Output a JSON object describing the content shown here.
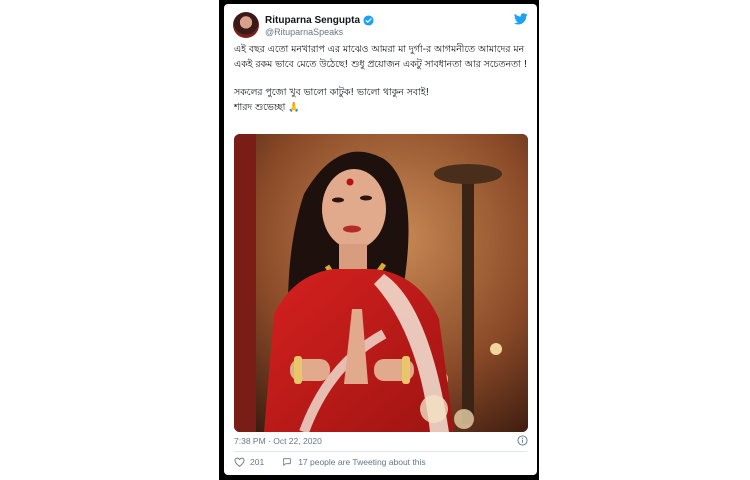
{
  "author": {
    "name": "Rituparna Sengupta",
    "handle": "@RituparnaSpeaks",
    "verified": true
  },
  "tweet": {
    "lines_block1": "এই বছর এতো মনখারাপ এর মাঝেও আমরা মা দুর্গা-র আগমনীতে আমাদের মন একই রকম ভাবে মেতে উঠেছে! শুধু প্রয়োজন একটু সাবধানতা আর সচেতনতা !",
    "lines_block2a": "সকলের পুজো খুব ভালো কাটুক! ভালো থাকুন সবাই!",
    "lines_block2b": "শারদ শুভেচ্ছা 🙏"
  },
  "timestamp": "7:38 PM · Oct 22, 2020",
  "likes": "201",
  "conversation": "17 people are Tweeting about this",
  "icons": {
    "logo": "twitter-bird-icon",
    "verified": "verified-badge-icon",
    "info": "info-icon",
    "like": "heart-icon",
    "conversation": "speech-bubble-icon"
  },
  "colors": {
    "twitter_blue": "#1da1f2",
    "text": "#14171a",
    "muted": "#657786"
  }
}
